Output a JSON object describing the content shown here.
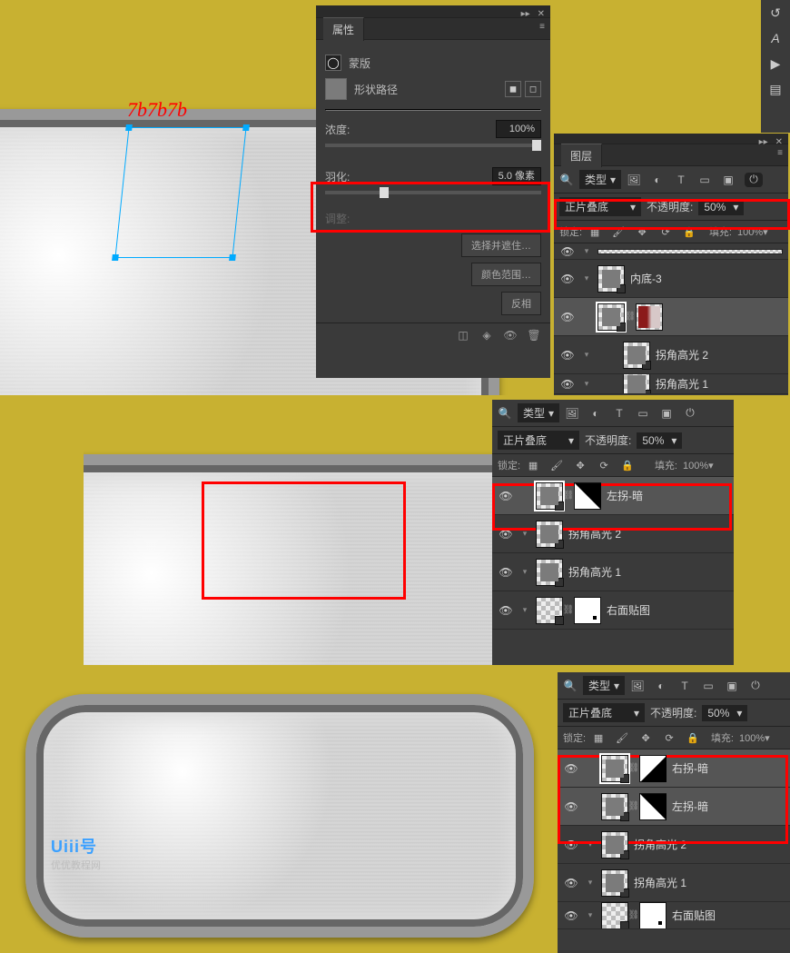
{
  "annotation_color_hex": "7b7b7b",
  "properties_panel": {
    "title": "属性",
    "mask_label": "蒙版",
    "shape_path_label": "形状路径",
    "density_label": "浓度:",
    "density_value": "100%",
    "feather_label": "羽化:",
    "feather_value": "5.0 像素",
    "adjust_label": "调整:",
    "btn_select_and_mask": "选择并遮住…",
    "btn_color_range": "颜色范围…",
    "btn_invert": "反相"
  },
  "sections": [
    {
      "layers_panel": {
        "title": "图层",
        "filter_label": "类型",
        "blend_mode": "正片叠底",
        "opacity_label": "不透明度:",
        "opacity_value": "50%",
        "lock_label": "锁定:",
        "fill_label": "填充:",
        "fill_value": "100%",
        "layers": [
          {
            "name": "内底-3",
            "visible": true,
            "masked": true,
            "thumb": "grey"
          },
          {
            "name": "",
            "visible": true,
            "masked": true,
            "thumb": "red",
            "selected": true
          },
          {
            "name": "拐角高光 2",
            "visible": true,
            "masked": true,
            "thumb": "grey"
          },
          {
            "name": "拐角高光 1",
            "visible": true,
            "masked": true,
            "thumb": "grey",
            "truncated": true
          }
        ]
      }
    },
    {
      "layers_panel": {
        "filter_label": "类型",
        "blend_mode": "正片叠底",
        "opacity_label": "不透明度:",
        "opacity_value": "50%",
        "lock_label": "锁定:",
        "fill_label": "填充:",
        "fill_value": "100%",
        "layers": [
          {
            "name": "左拐-暗",
            "visible": true,
            "masked": true,
            "thumb": "tri",
            "selected": true
          },
          {
            "name": "拐角高光 2",
            "visible": true,
            "masked": true,
            "thumb": "grey"
          },
          {
            "name": "拐角高光 1",
            "visible": true,
            "masked": true,
            "thumb": "grey"
          },
          {
            "name": "右面贴图",
            "visible": true,
            "masked": true,
            "thumb": "dot"
          }
        ]
      }
    },
    {
      "layers_panel": {
        "filter_label": "类型",
        "blend_mode": "正片叠底",
        "opacity_label": "不透明度:",
        "opacity_value": "50%",
        "lock_label": "锁定:",
        "fill_label": "填充:",
        "fill_value": "100%",
        "layers": [
          {
            "name": "右拐-暗",
            "visible": true,
            "masked": true,
            "thumb": "tri-r",
            "selected": true
          },
          {
            "name": "左拐-暗",
            "visible": true,
            "masked": true,
            "thumb": "tri",
            "selected": true
          },
          {
            "name": "拐角高光 2",
            "visible": true,
            "masked": true,
            "thumb": "grey"
          },
          {
            "name": "拐角高光 1",
            "visible": true,
            "masked": true,
            "thumb": "grey"
          },
          {
            "name": "右面贴图",
            "visible": true,
            "masked": true,
            "thumb": "dot"
          }
        ]
      }
    }
  ],
  "watermark": {
    "logo": "Uiii号",
    "text": "优优教程网"
  }
}
